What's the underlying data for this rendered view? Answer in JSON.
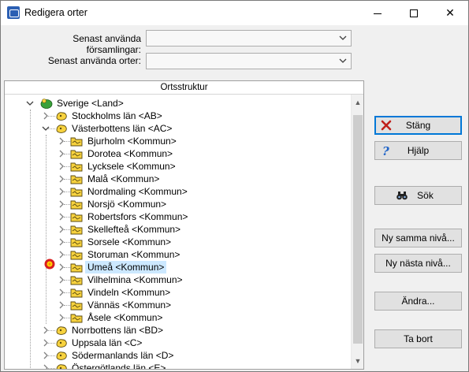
{
  "window": {
    "title": "Redigera orter"
  },
  "form": {
    "label_forsamlingar": "Senast använda församlingar:",
    "label_orter": "Senast använda orter:",
    "value_forsamlingar": "",
    "value_orter": ""
  },
  "tree": {
    "header": "Ortsstruktur",
    "nodes": [
      {
        "label": "Sverige <Land>"
      },
      {
        "label": "Stockholms län <AB>"
      },
      {
        "label": "Västerbottens län <AC>"
      },
      {
        "label": "Bjurholm <Kommun>"
      },
      {
        "label": "Dorotea <Kommun>"
      },
      {
        "label": "Lycksele <Kommun>"
      },
      {
        "label": "Malå <Kommun>"
      },
      {
        "label": "Nordmaling <Kommun>"
      },
      {
        "label": "Norsjö <Kommun>"
      },
      {
        "label": "Robertsfors <Kommun>"
      },
      {
        "label": "Skellefteå <Kommun>"
      },
      {
        "label": "Sorsele <Kommun>"
      },
      {
        "label": "Storuman <Kommun>"
      },
      {
        "label": "Umeå <Kommun>"
      },
      {
        "label": "Vilhelmina <Kommun>"
      },
      {
        "label": "Vindeln <Kommun>"
      },
      {
        "label": "Vännäs <Kommun>"
      },
      {
        "label": "Åsele <Kommun>"
      },
      {
        "label": "Norrbottens län <BD>"
      },
      {
        "label": "Uppsala län <C>"
      },
      {
        "label": "Södermanlands län <D>"
      },
      {
        "label": "Östergötlands län <E>"
      }
    ],
    "selected": "Umeå <Kommun>"
  },
  "buttons": {
    "close": "Stäng",
    "help": "Hjälp",
    "search": "Sök",
    "new_same_level": "Ny samma nivå...",
    "new_next_level": "Ny nästa nivå...",
    "change": "Ändra...",
    "remove": "Ta bort"
  },
  "colors": {
    "selection": "#cce8ff",
    "default_button_border": "#0078d7",
    "folder_yellow": "#f7d23e",
    "root_green": "#3aa13a",
    "close_red": "#c0201b",
    "help_blue": "#1e63c8"
  },
  "icons": {
    "root": "globe-country-icon",
    "county": "map-county-icon",
    "municipality": "folder-municipality-icon",
    "marker": "current-location-marker-icon"
  }
}
